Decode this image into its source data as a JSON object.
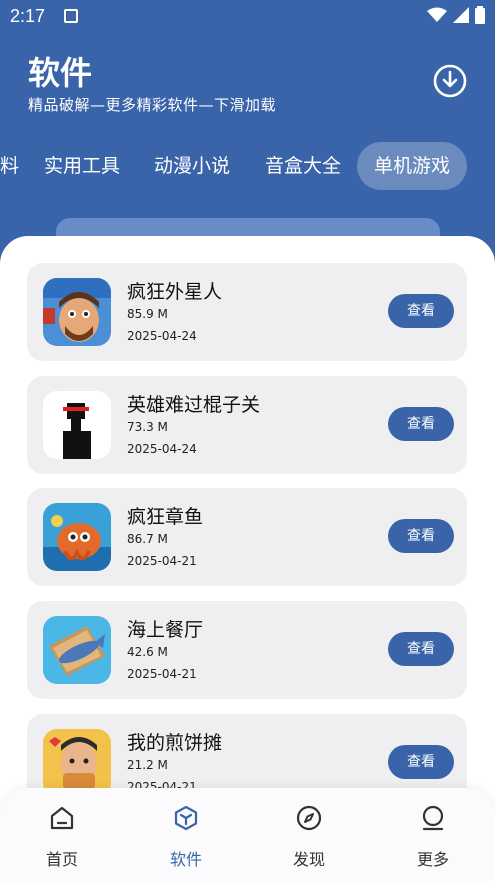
{
  "status": {
    "time": "2:17"
  },
  "header": {
    "title": "软件",
    "subtitle": "精品破解—更多精彩软件—下滑加载"
  },
  "tabs": [
    {
      "label": "料",
      "active": false
    },
    {
      "label": "实用工具",
      "active": false
    },
    {
      "label": "动漫小说",
      "active": false
    },
    {
      "label": "音盒大全",
      "active": false
    },
    {
      "label": "单机游戏",
      "active": true
    }
  ],
  "items": [
    {
      "name": "疯狂外星人",
      "size": "85.9 M",
      "date": "2025-04-24",
      "button": "查看",
      "icon": "crazy-alien-icon"
    },
    {
      "name": "英雄难过棍子关",
      "size": "73.3 M",
      "date": "2025-04-24",
      "button": "查看",
      "icon": "stick-hero-icon"
    },
    {
      "name": "疯狂章鱼",
      "size": "86.7 M",
      "date": "2025-04-21",
      "button": "查看",
      "icon": "crazy-octopus-icon"
    },
    {
      "name": "海上餐厅",
      "size": "42.6 M",
      "date": "2025-04-21",
      "button": "查看",
      "icon": "sea-restaurant-icon"
    },
    {
      "name": "我的煎饼摊",
      "size": "21.2 M",
      "date": "2025-04-21",
      "button": "查看",
      "icon": "pancake-stall-icon"
    }
  ],
  "nav": [
    {
      "label": "首页",
      "icon": "home-icon",
      "active": false
    },
    {
      "label": "软件",
      "icon": "software-icon",
      "active": true
    },
    {
      "label": "发现",
      "icon": "compass-icon",
      "active": false
    },
    {
      "label": "更多",
      "icon": "more-icon",
      "active": false
    }
  ],
  "colors": {
    "primary": "#3a64a9",
    "card": "#efeff1",
    "sheet": "#ffffff"
  }
}
